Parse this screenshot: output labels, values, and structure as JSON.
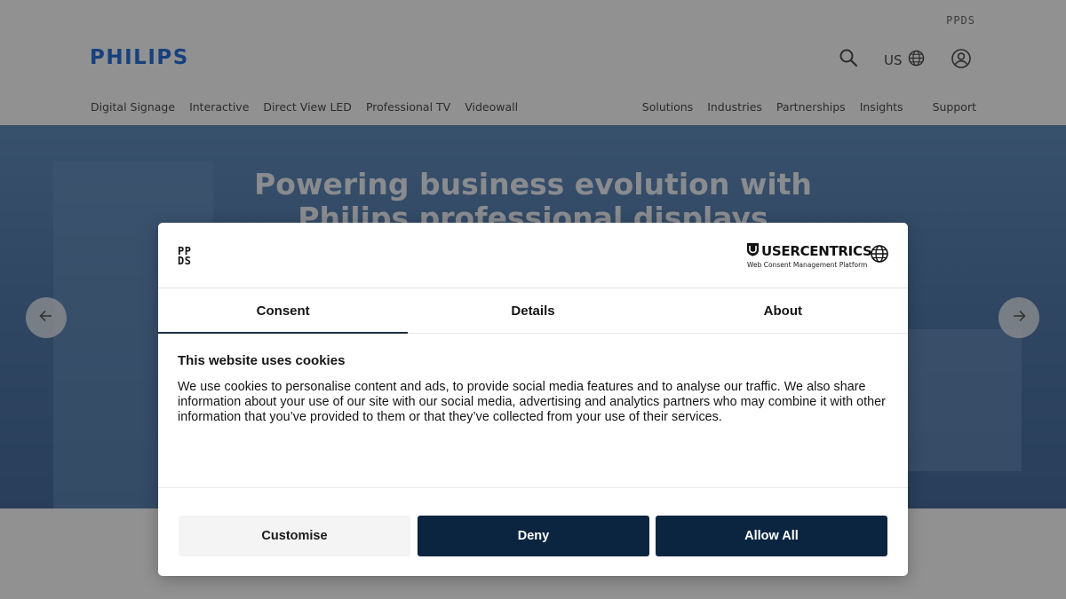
{
  "site": {
    "brand_tag": "PPDS",
    "logo": "PHILIPS",
    "region_label": "US",
    "nav_primary": [
      "Digital Signage",
      "Interactive",
      "Direct View LED",
      "Professional TV",
      "Videowall"
    ],
    "nav_secondary": [
      "Solutions",
      "Industries",
      "Partnerships",
      "Insights"
    ],
    "nav_support": "Support",
    "hero_title_line1": "Powering business evolution with",
    "hero_title_line2": "Philips professional displays"
  },
  "dialog": {
    "provider": {
      "logo_line1": "PP",
      "logo_line2": "DS",
      "cmp_name": "USERCENTRICS",
      "cmp_tagline": "Web Consent Management Platform"
    },
    "tabs": [
      "Consent",
      "Details",
      "About"
    ],
    "active_tab": "Consent",
    "title": "This website uses cookies",
    "text": "We use cookies to personalise content and ads, to provide social media features and to analyse our traffic. We also share information about your use of our site with our social media, advertising and analytics partners who may combine it with other information that you’ve provided to them or that they’ve collected from your use of their services.",
    "buttons": {
      "customise": "Customise",
      "deny": "Deny",
      "allow_all": "Allow All"
    }
  },
  "colors": {
    "primary_dark": "#0b2541",
    "philips_blue": "#0b5ed7",
    "hero_blue": "#3c6aa2"
  }
}
